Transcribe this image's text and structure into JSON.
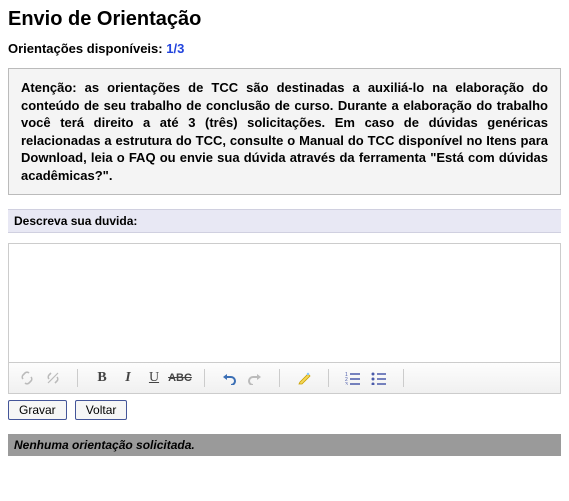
{
  "page": {
    "title": "Envio de Orientação",
    "available_label": "Orientações disponíveis:",
    "available_count": "1/3",
    "notice": "Atenção: as orientações de TCC são destinadas a auxiliá-lo na elaboração do conteúdo de seu trabalho de conclusão de curso. Durante a elaboração do trabalho você terá direito a até 3 (três) solicitações. Em caso de dúvidas genéricas relacionadas a estrutura do TCC, consulte o Manual do TCC disponível no Itens para Download, leia o FAQ ou envie sua dúvida através da ferramenta \"Está com dúvidas acadêmicas?\".",
    "describe_label": "Descreva sua duvida:",
    "editor_value": "",
    "editor_placeholder": ""
  },
  "toolbar": {
    "link": "link-icon",
    "unlink": "unlink-icon",
    "bold": "B",
    "italic": "I",
    "underline": "U",
    "strike": "ABC",
    "undo": "undo-icon",
    "redo": "redo-icon",
    "clear": "clear-format-icon",
    "numlist": "numbered-list-icon",
    "bullist": "bullet-list-icon"
  },
  "buttons": {
    "save": "Gravar",
    "back": "Voltar"
  },
  "status": {
    "text": "Nenhuma orientação solicitada."
  }
}
